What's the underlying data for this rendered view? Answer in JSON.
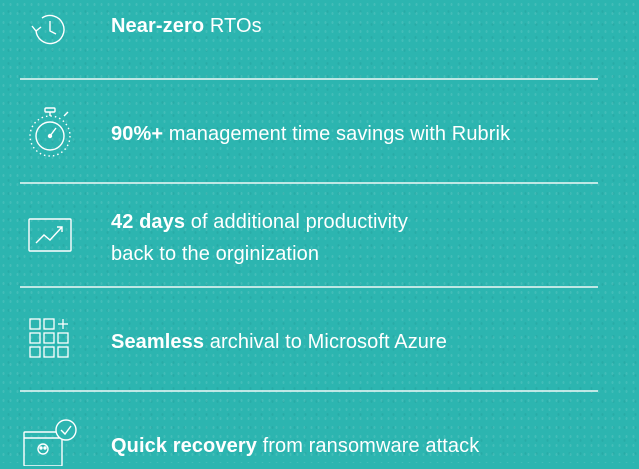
{
  "items": [
    {
      "bold": "Near-zero",
      "rest": " RTOs",
      "icon": "history-clock-icon"
    },
    {
      "bold": "90%+",
      "rest": " management time savings with Rubrik",
      "icon": "stopwatch-icon"
    },
    {
      "bold": "42 days",
      "rest": " of additional productivity",
      "rest2": "back to the orginization",
      "icon": "trend-chart-icon"
    },
    {
      "bold": "Seamless",
      "rest": " archival to Microsoft Azure",
      "icon": "grid-add-icon"
    },
    {
      "bold": "Quick recovery",
      "rest": " from ransomware attack",
      "icon": "ransomware-check-icon"
    }
  ],
  "colors": {
    "background": "#2cb5b0",
    "text": "#ffffff",
    "divider": "#d8f1ef"
  }
}
